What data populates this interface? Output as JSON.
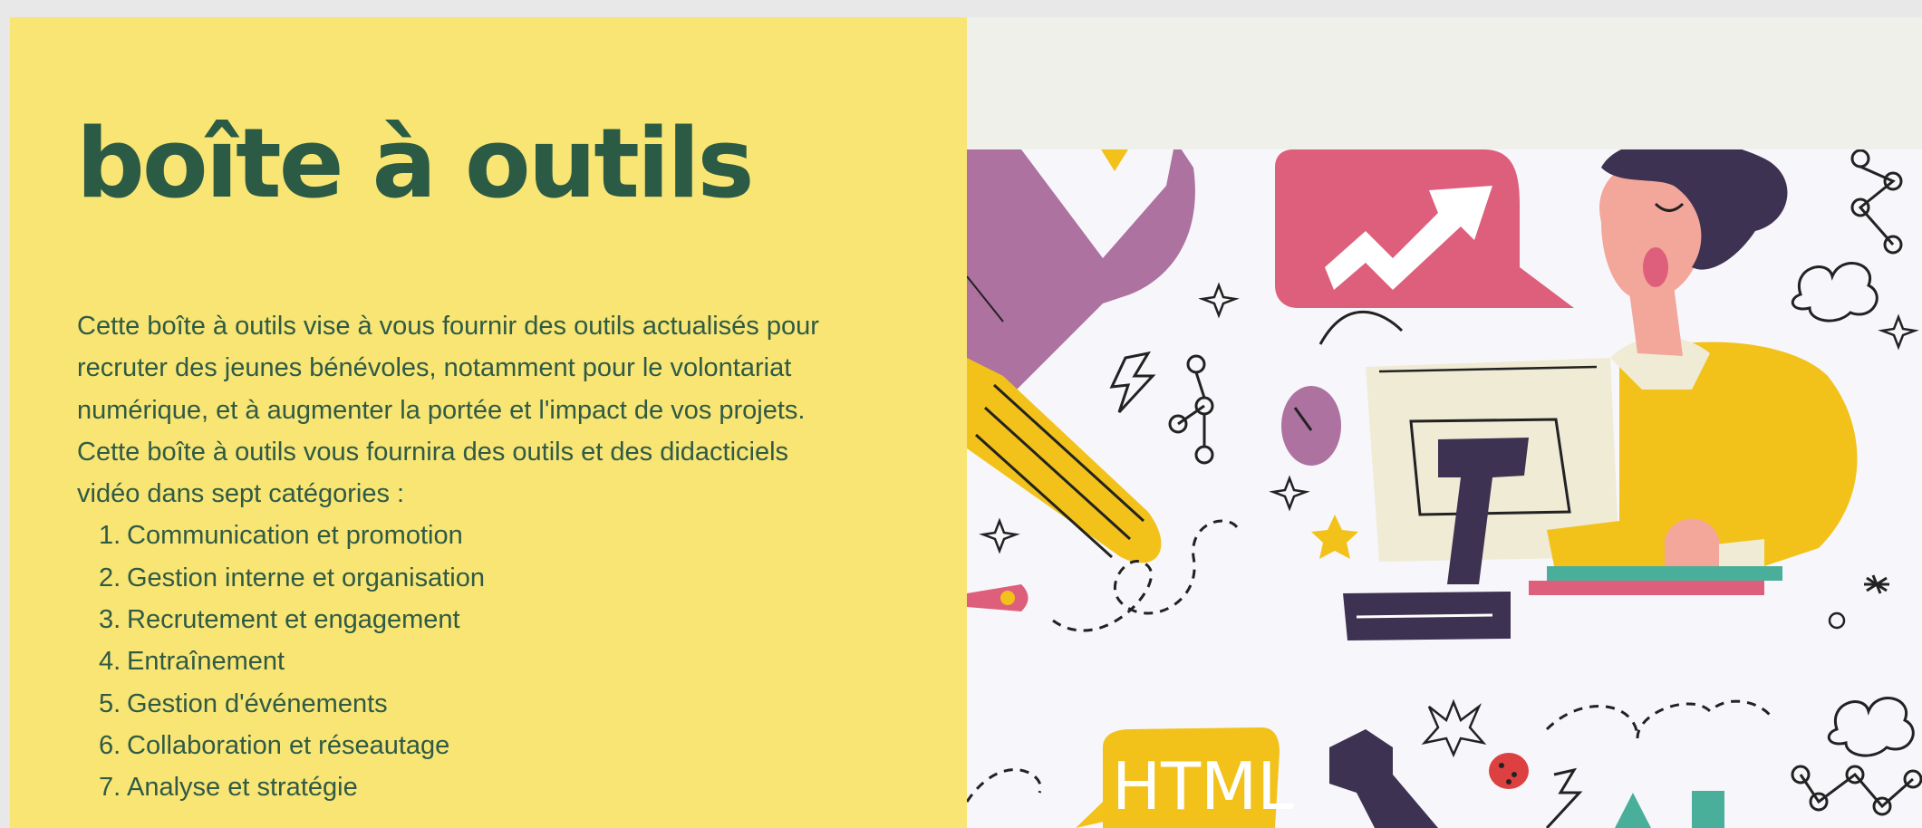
{
  "header": {
    "title": "boîte à outils"
  },
  "intro": {
    "paragraph1": "Cette boîte à outils vise à vous fournir des outils actualisés pour recruter des jeunes bénévoles, notamment pour le volontariat numérique, et à augmenter la portée et l'impact de vos projets.",
    "paragraph2": "Cette boîte à outils vous fournira des outils et des didacticiels vidéo dans sept catégories :"
  },
  "categories": [
    {
      "num": "1.",
      "label": "Communication et promotion"
    },
    {
      "num": "2.",
      "label": "Gestion interne et organisation"
    },
    {
      "num": "3.",
      "label": "Recrutement et engagement"
    },
    {
      "num": "4.",
      "label": "Entraînement"
    },
    {
      "num": "5.",
      "label": "Gestion d'événements"
    },
    {
      "num": "6.",
      "label": "Collaboration et réseautage"
    },
    {
      "num": "7.",
      "label": "Analyse et stratégie"
    }
  ],
  "illustration": {
    "html_bubble_text": "HTML",
    "icons": [
      "wrench-icon",
      "chart-up-bubble-icon",
      "computer-mouse-icon",
      "rocket-icon",
      "ladybug-icon",
      "cloud-icon",
      "lightning-icon",
      "star-icon",
      "network-nodes-icon"
    ]
  },
  "colors": {
    "panel_yellow": "#f8e574",
    "text_green": "#2b5b45",
    "illustration_bg": "#f7f7fb",
    "band": "#f0f0ea",
    "accent_yellow": "#f2c21b",
    "accent_pink": "#dd5f7b",
    "accent_purple": "#ad72a0",
    "accent_navy": "#3e3252",
    "accent_teal": "#4aaf9a"
  }
}
